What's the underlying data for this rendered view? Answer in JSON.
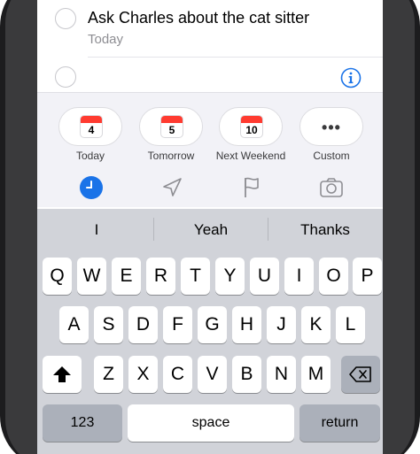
{
  "reminders": [
    {
      "title": "Ask Charles about the cat sitter",
      "date": "Today"
    },
    {
      "title": "",
      "date": ""
    }
  ],
  "date_suggestions": [
    {
      "day": "4",
      "label": "Today"
    },
    {
      "day": "5",
      "label": "Tomorrow"
    },
    {
      "day": "10",
      "label": "Next Weekend"
    },
    {
      "day": "",
      "label": "Custom"
    }
  ],
  "toolbar_icons": [
    "clock-icon",
    "location-arrow-icon",
    "flag-icon",
    "camera-icon"
  ],
  "predictive": [
    "I",
    "Yeah",
    "Thanks"
  ],
  "keyboard": {
    "row1": [
      "Q",
      "W",
      "E",
      "R",
      "T",
      "Y",
      "U",
      "I",
      "O",
      "P"
    ],
    "row2": [
      "A",
      "S",
      "D",
      "F",
      "G",
      "H",
      "J",
      "K",
      "L"
    ],
    "row3": [
      "Z",
      "X",
      "C",
      "V",
      "B",
      "N",
      "M"
    ],
    "numbers_label": "123",
    "space_label": "space",
    "return_label": "return"
  },
  "colors": {
    "accent": "#1a73e8",
    "calendar_red": "#ff3b30"
  }
}
